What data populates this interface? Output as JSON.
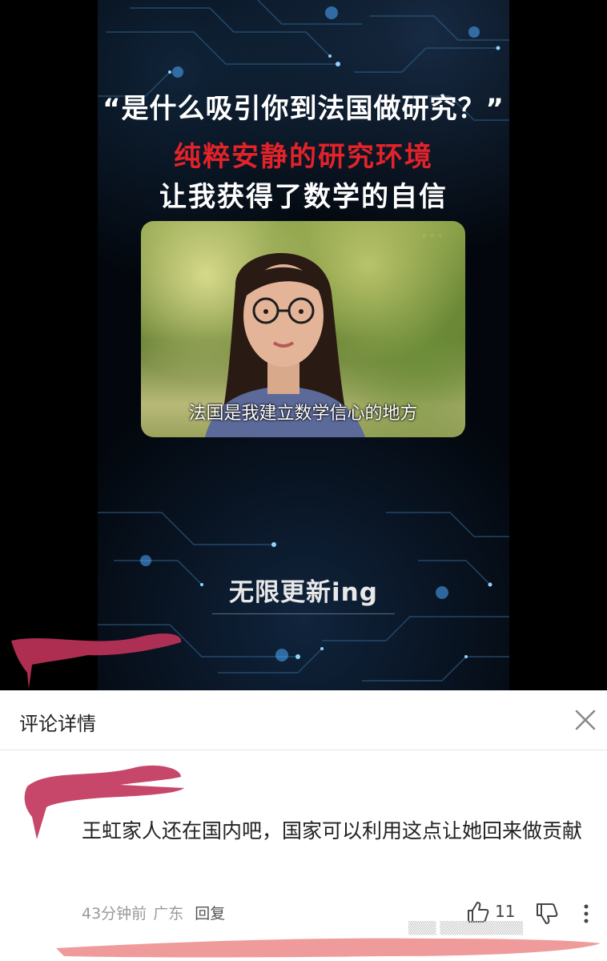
{
  "video": {
    "quote": "“是什么吸引你到法国做研究？”",
    "headline_red": "纯粹安静的研究环境",
    "headline_white": "让我获得了数学的自信",
    "subtitle": "法国是我建立数学信心的地方",
    "update_text": "无限更新ing",
    "accent_red": "#e3222a"
  },
  "comment_sheet": {
    "title": "评论详情",
    "close_icon": "close-icon",
    "comment": {
      "text": "王虹家人还在国内吧，国家可以利用这点让她回来做贡献",
      "time": "43分钟前",
      "location": "广东",
      "reply_label": "回复",
      "like_count": "11"
    }
  },
  "colors": {
    "scribble": "#c0335a",
    "sheet_bg": "#ffffff"
  }
}
